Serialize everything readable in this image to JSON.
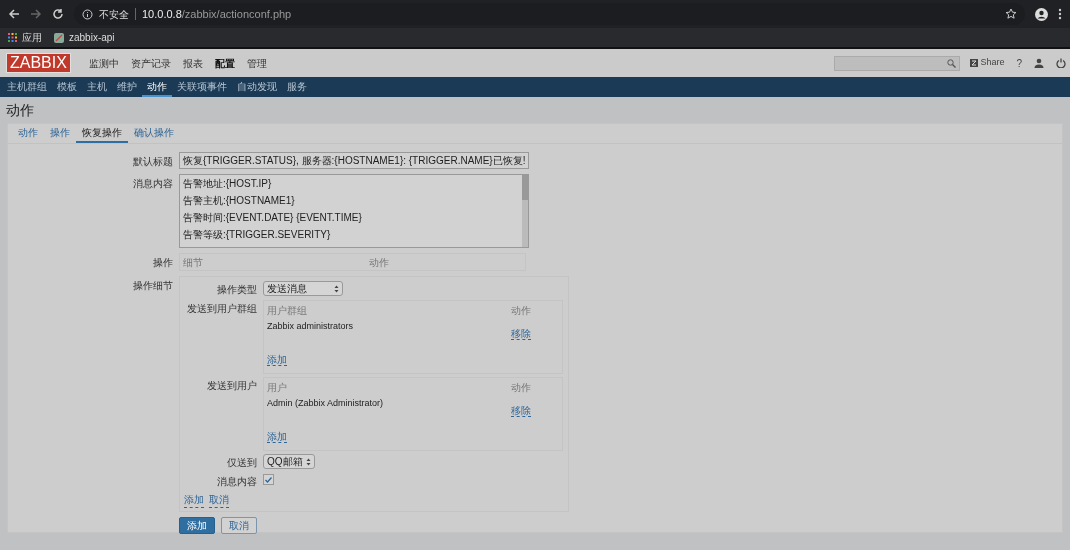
{
  "browser": {
    "security": "不安全",
    "url": "**10.0.0.8**/zabbix/actionconf.php",
    "bookmarks": [
      {
        "label": "应用",
        "kind": "apps"
      },
      {
        "label": "zabbix-api",
        "kind": "site"
      }
    ]
  },
  "header": {
    "logo": "ZABBIX",
    "menu": [
      {
        "label": "监测中",
        "selected": false
      },
      {
        "label": "资产记录",
        "selected": false
      },
      {
        "label": "报表",
        "selected": false
      },
      {
        "label": "配置",
        "selected": true
      },
      {
        "label": "管理",
        "selected": false
      }
    ],
    "share": "Share",
    "help": "?"
  },
  "subnav": [
    {
      "label": "主机群组",
      "selected": false
    },
    {
      "label": "模板",
      "selected": false
    },
    {
      "label": "主机",
      "selected": false
    },
    {
      "label": "维护",
      "selected": false
    },
    {
      "label": "动作",
      "selected": true
    },
    {
      "label": "关联项事件",
      "selected": false
    },
    {
      "label": "自动发现",
      "selected": false
    },
    {
      "label": "服务",
      "selected": false
    }
  ],
  "page_title": "动作",
  "tabs": [
    {
      "label": "动作",
      "selected": false
    },
    {
      "label": "操作",
      "selected": false
    },
    {
      "label": "恢复操作",
      "selected": true
    },
    {
      "label": "确认操作",
      "selected": false
    }
  ],
  "form": {
    "default_subject": {
      "label": "默认标题",
      "value": "恢复{TRIGGER.STATUS}, 服务器:{HOSTNAME1}: {TRIGGER.NAME}已恢复!"
    },
    "message": {
      "label": "消息内容",
      "lines": [
        "告警地址:{HOST.IP}",
        "告警主机:{HOSTNAME1}",
        "告警时间:{EVENT.DATE} {EVENT.TIME}",
        "告警等级:{TRIGGER.SEVERITY}"
      ]
    },
    "operations": {
      "label": "操作",
      "columns": [
        "细节",
        "动作"
      ]
    },
    "details": {
      "label": "操作细节",
      "type": {
        "label": "操作类型",
        "value": "发送消息"
      },
      "lists": [
        {
          "label": "发送到用户群组",
          "columns": [
            "用户群组",
            "动作"
          ],
          "rows": [
            {
              "name": "Zabbix administrators",
              "action": "移除"
            }
          ],
          "add": "添加"
        },
        {
          "label": "发送到用户",
          "columns": [
            "用户",
            "动作"
          ],
          "rows": [
            {
              "name": "Admin (Zabbix Administrator)",
              "action": "移除"
            }
          ],
          "add": "添加"
        }
      ],
      "send_only": {
        "label": "仅送到",
        "value": "QQ邮箱"
      },
      "message_content": {
        "label": "消息内容",
        "checked": true
      },
      "links": [
        "添加",
        "取消"
      ]
    },
    "buttons": [
      {
        "label": "添加",
        "primary": true
      },
      {
        "label": "取消",
        "primary": false
      }
    ]
  }
}
